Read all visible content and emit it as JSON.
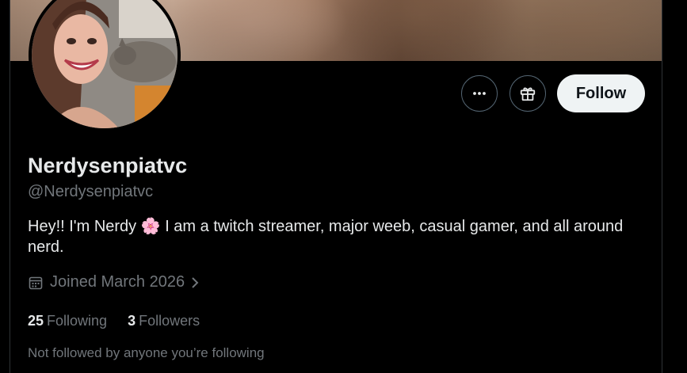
{
  "profile": {
    "display_name": "Nerdysenpiatvc",
    "handle": "@Nerdysenpiatvc",
    "bio_text_1": "Hey!! I'm Nerdy ",
    "bio_emoji": "🌸",
    "bio_text_2": " I am a twitch streamer, major weeb, casual gamer, and all around nerd.",
    "joined": "Joined March 2026"
  },
  "stats": {
    "following_count": "25",
    "following_label": "Following",
    "followers_count": "3",
    "followers_label": "Followers"
  },
  "social_context": "Not followed by anyone you’re following",
  "actions": {
    "more_icon": "more-horizontal-icon",
    "gift_icon": "gift-icon",
    "follow_label": "Follow"
  },
  "colors": {
    "background": "#000000",
    "text_primary": "#e7e9ea",
    "text_secondary": "#71767b",
    "follow_button_bg": "#eff3f4",
    "border": "#536471"
  }
}
